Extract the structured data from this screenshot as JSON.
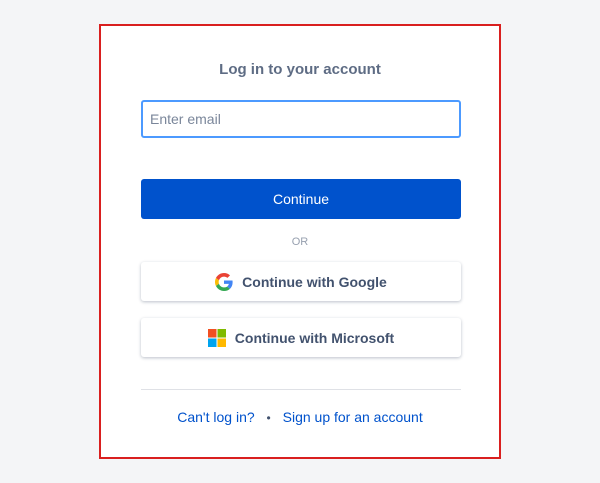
{
  "login": {
    "title": "Log in to your account",
    "email_placeholder": "Enter email",
    "email_value": "",
    "continue_label": "Continue",
    "or_label": "OR",
    "google_label": "Continue with Google",
    "microsoft_label": "Continue with Microsoft",
    "cant_login_label": "Can't log in?",
    "separator": "•",
    "signup_label": "Sign up for an account"
  },
  "colors": {
    "primary": "#0052cc",
    "focus_border": "#4c9aff",
    "highlight_border": "#d91f1f",
    "page_background": "#f4f5f7"
  },
  "icons": {
    "google": "google-icon",
    "microsoft": "microsoft-icon"
  }
}
